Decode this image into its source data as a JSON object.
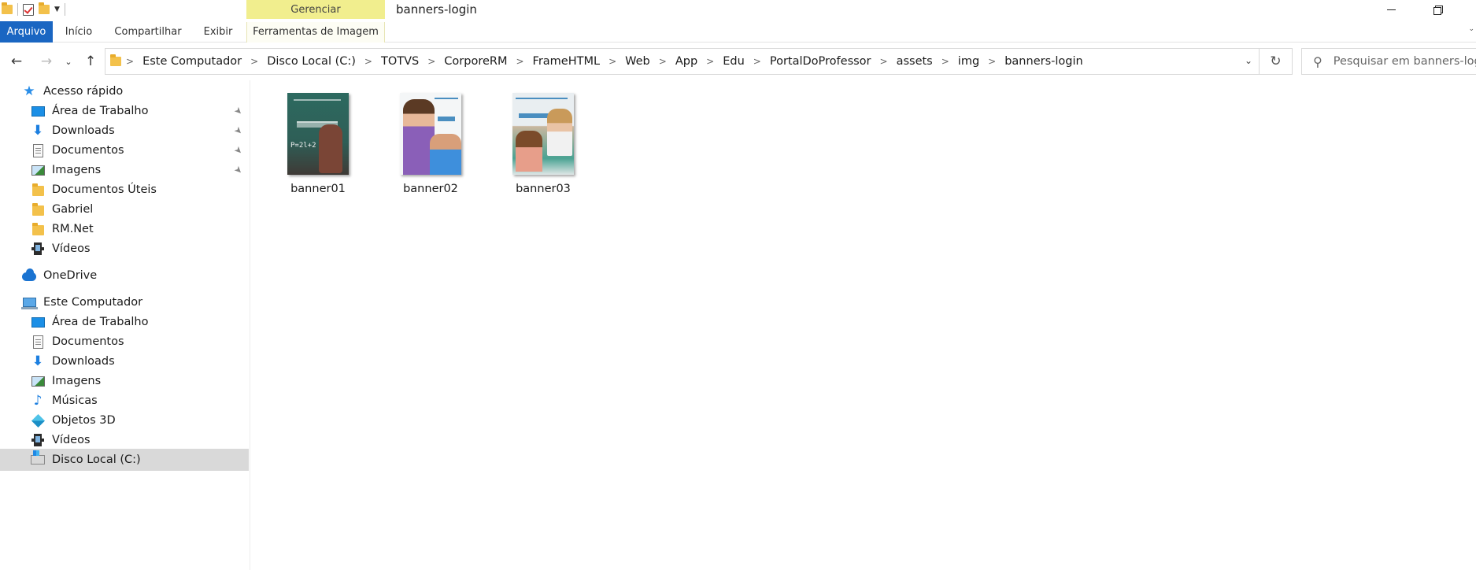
{
  "window": {
    "title": "banners-login",
    "context_tab_group": "Gerenciar"
  },
  "ribbon": {
    "tabs": [
      {
        "label": "Arquivo"
      },
      {
        "label": "Início"
      },
      {
        "label": "Compartilhar"
      },
      {
        "label": "Exibir"
      },
      {
        "label": "Ferramentas de Imagem"
      }
    ]
  },
  "address": {
    "crumbs": [
      "Este Computador",
      "Disco Local (C:)",
      "TOTVS",
      "CorporeRM",
      "FrameHTML",
      "Web",
      "App",
      "Edu",
      "PortalDoProfessor",
      "assets",
      "img",
      "banners-login"
    ]
  },
  "search": {
    "placeholder": "Pesquisar em banners-login"
  },
  "sidebar": {
    "items": [
      {
        "label": "Acesso rápido",
        "icon": "star-icon"
      },
      {
        "label": "Área de Trabalho",
        "icon": "desktop-icon",
        "pinned": true
      },
      {
        "label": "Downloads",
        "icon": "download-icon",
        "pinned": true
      },
      {
        "label": "Documentos",
        "icon": "document-icon",
        "pinned": true
      },
      {
        "label": "Imagens",
        "icon": "image-icon",
        "pinned": true
      },
      {
        "label": "Documentos Úteis",
        "icon": "folder-icon"
      },
      {
        "label": "Gabriel",
        "icon": "folder-icon"
      },
      {
        "label": "RM.Net",
        "icon": "folder-icon"
      },
      {
        "label": "Vídeos",
        "icon": "video-icon"
      },
      {
        "label": "OneDrive",
        "icon": "cloud-icon"
      },
      {
        "label": "Este Computador",
        "icon": "computer-icon"
      },
      {
        "label": "Área de Trabalho",
        "icon": "desktop-icon"
      },
      {
        "label": "Documentos",
        "icon": "document-icon"
      },
      {
        "label": "Downloads",
        "icon": "download-icon"
      },
      {
        "label": "Imagens",
        "icon": "image-icon"
      },
      {
        "label": "Músicas",
        "icon": "music-icon"
      },
      {
        "label": "Objetos 3D",
        "icon": "3d-objects-icon"
      },
      {
        "label": "Vídeos",
        "icon": "video-icon"
      },
      {
        "label": "Disco Local (C:)",
        "icon": "drive-icon",
        "selected": true
      }
    ]
  },
  "files": [
    {
      "name": "banner01",
      "thumb_text": "P=2l+2"
    },
    {
      "name": "banner02"
    },
    {
      "name": "banner03"
    }
  ],
  "colors": {
    "accent": "#1a66c2",
    "context_tab": "#f1ee8e",
    "selected_bg": "#d9d9d9"
  }
}
